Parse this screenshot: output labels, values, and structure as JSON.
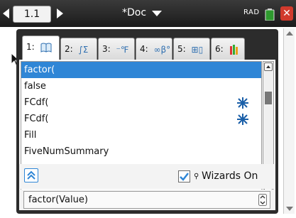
{
  "header": {
    "page_tab": "1.1",
    "doc_title": "*Doc",
    "angle_mode": "RAD"
  },
  "catalog": {
    "tabs": [
      {
        "number": "1:",
        "icon": "book-icon"
      },
      {
        "number": "2:",
        "icon": "integral-sigma-icon"
      },
      {
        "number": "3:",
        "icon": "unit-conversion-icon"
      },
      {
        "number": "4:",
        "icon": "infinity-beta-icon"
      },
      {
        "number": "5:",
        "icon": "template-icon"
      },
      {
        "number": "6:",
        "icon": "library-icon"
      }
    ],
    "active_tab": 0,
    "items": [
      {
        "label": "factor(",
        "selected": true,
        "wizard": false
      },
      {
        "label": "false",
        "selected": false,
        "wizard": false
      },
      {
        "label": "FCdf(",
        "selected": false,
        "wizard": true
      },
      {
        "label": "FCdf(",
        "selected": false,
        "wizard": true
      },
      {
        "label": "Fill",
        "selected": false,
        "wizard": false
      },
      {
        "label": "FiveNumSummary",
        "selected": false,
        "wizard": false
      }
    ],
    "wizards_label": "Wizards On",
    "wizards_checked": true,
    "syntax": "factor(Value)"
  },
  "colors": {
    "selection": "#2f86d6",
    "wizard_icon": "#1a5fa8",
    "close": "#d13a2c",
    "dialog_frame": "#2c2c2c"
  }
}
